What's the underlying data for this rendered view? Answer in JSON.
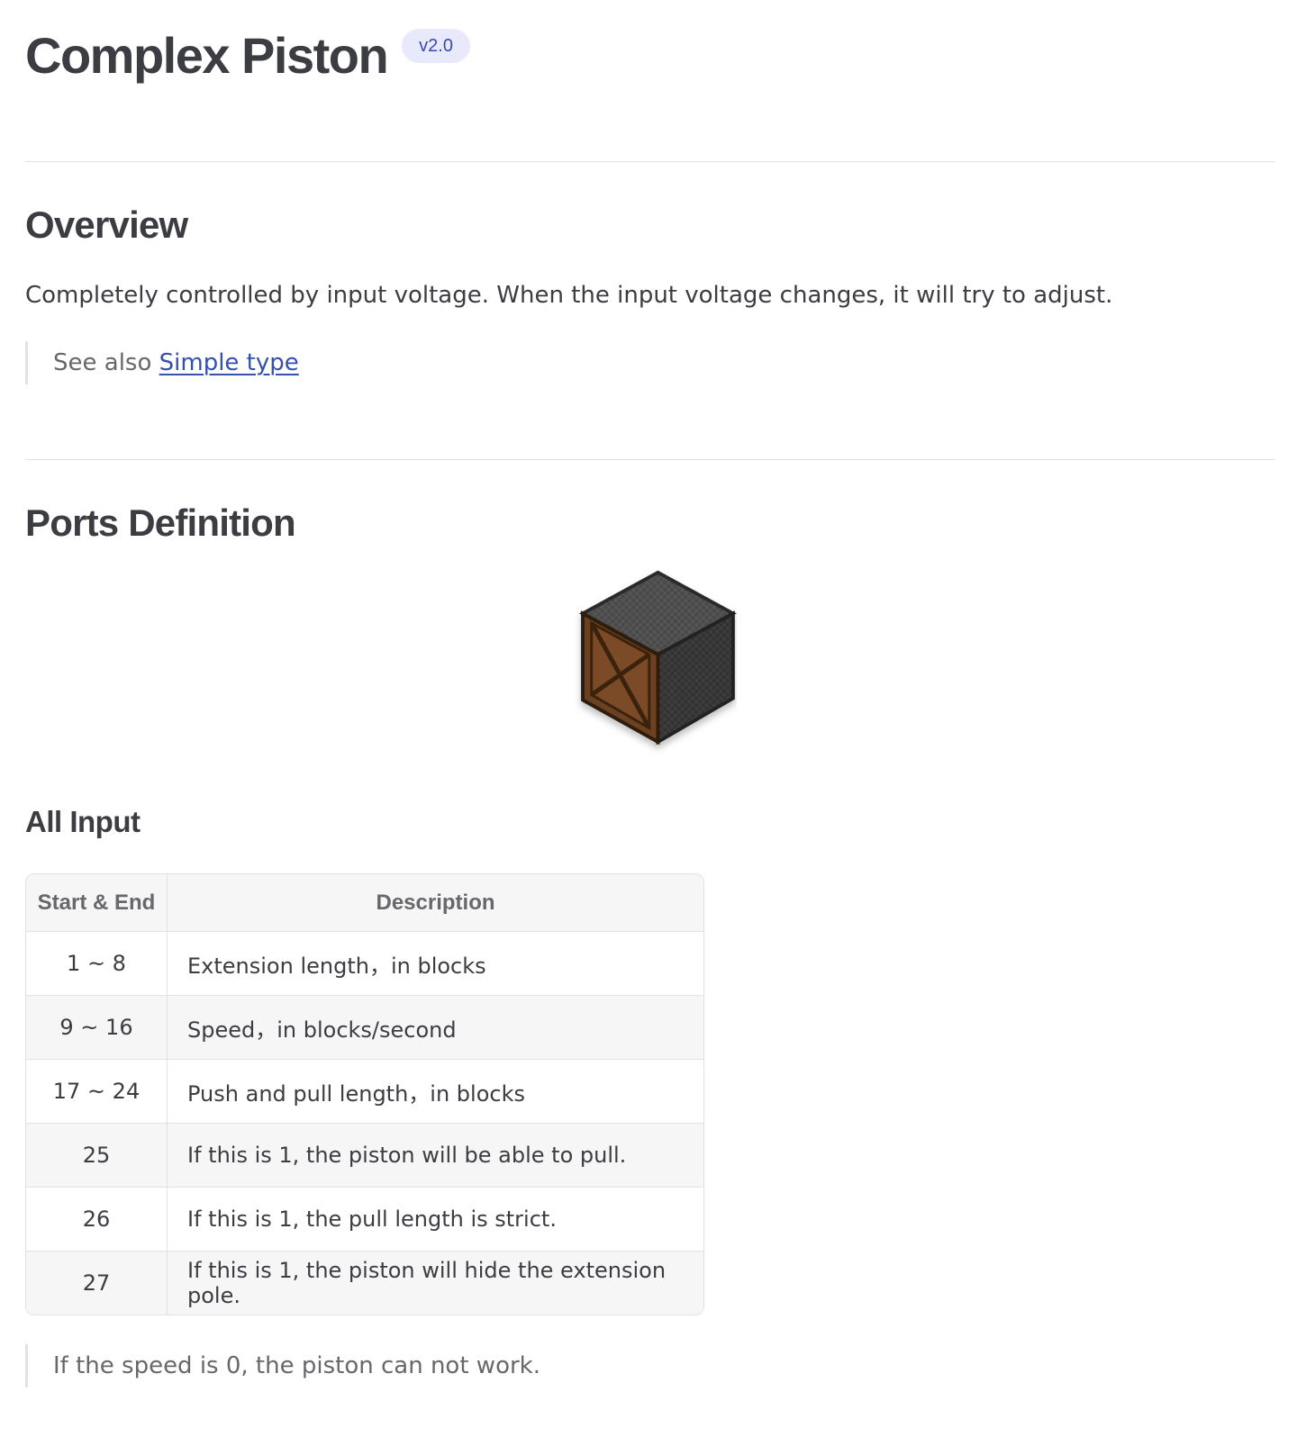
{
  "header": {
    "title": "Complex Piston",
    "version_badge": "v2.0"
  },
  "overview": {
    "heading": "Overview",
    "description": "Completely controlled by input voltage. When the input voltage changes, it will try to adjust.",
    "see_also_prefix": "See also ",
    "see_also_link": "Simple type"
  },
  "ports": {
    "heading": "Ports Definition",
    "image_icon": "complex-piston-block-icon",
    "all_input_heading": "All Input",
    "table": {
      "headers": [
        "Start & End",
        "Description"
      ],
      "rows": [
        {
          "range": "1 ~ 8",
          "description": "Extension length，in blocks"
        },
        {
          "range": "9 ~ 16",
          "description": "Speed，in blocks/second"
        },
        {
          "range": "17 ~ 24",
          "description": "Push and pull length，in blocks"
        },
        {
          "range": "25",
          "description": "If this is 1, the piston will be able to pull."
        },
        {
          "range": "26",
          "description": "If this is 1, the pull length is strict."
        },
        {
          "range": "27",
          "description": "If this is 1, the piston will hide the extension pole."
        }
      ]
    },
    "note": "If the speed is 0, the piston can not work."
  },
  "colors": {
    "text": "#3c3c43",
    "muted": "#67676c",
    "link": "#3451b2",
    "badge_bg": "#e8eafc",
    "divider": "#e2e2e3"
  }
}
